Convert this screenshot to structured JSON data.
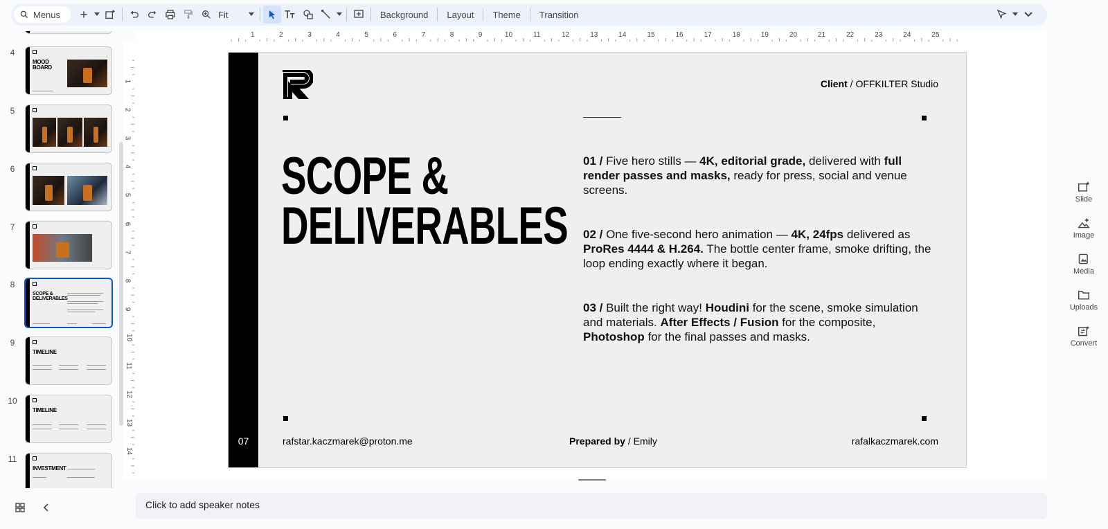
{
  "toolbar": {
    "menus_label": "Menus",
    "zoom_value": "Fit",
    "background_label": "Background",
    "layout_label": "Layout",
    "theme_label": "Theme",
    "transition_label": "Transition"
  },
  "filmstrip": {
    "slides": [
      {
        "number": "4",
        "title": "MOOD BOARD"
      },
      {
        "number": "5",
        "title": ""
      },
      {
        "number": "6",
        "title": ""
      },
      {
        "number": "7",
        "title": ""
      },
      {
        "number": "8",
        "title": "SCOPE & DELIVERABLES",
        "selected": true
      },
      {
        "number": "9",
        "title": "TIMELINE"
      },
      {
        "number": "10",
        "title": "TIMELINE"
      },
      {
        "number": "11",
        "title": "INVESTMENT"
      }
    ]
  },
  "ruler": {
    "top": [
      "1",
      "2",
      "3",
      "4",
      "5",
      "6",
      "7",
      "8",
      "9",
      "10",
      "11",
      "12",
      "13",
      "14",
      "15",
      "16",
      "17",
      "18",
      "19",
      "20",
      "21",
      "22",
      "23",
      "24",
      "25"
    ],
    "left": [
      "1",
      "2",
      "3",
      "4",
      "5",
      "6",
      "7",
      "8",
      "9",
      "10",
      "11",
      "12",
      "13",
      "14"
    ]
  },
  "slide": {
    "page_number": "07",
    "client_label": "Client",
    "client_sep": "/",
    "client_name": "OFFKILTER Studio",
    "title_line1": "SCOPE &",
    "title_line2": "DELIVERABLES",
    "items": [
      {
        "num": "01 /",
        "text_a": " Five hero stills — ",
        "bold_a": "4K, editorial grade,",
        "text_b": " delivered with ",
        "bold_b": "full render passes and masks,",
        "text_c": " ready for press, social and venue screens."
      },
      {
        "num": "02 /",
        "text_a": " One five-second hero animation — ",
        "bold_a": "4K, 24fps",
        "text_b": " delivered as ",
        "bold_b": "ProRes 4444 & H.264.",
        "text_c": " The bottle center frame, smoke drifting, the loop ending exactly where it began."
      },
      {
        "num": "03 /",
        "text_a": " Built the right way! ",
        "bold_a": "Houdini",
        "text_b": " for the scene, smoke simulation and materials. ",
        "bold_b": "After Effects / Fusion",
        "text_c": " for the composite, ",
        "bold_c": "Photoshop",
        "text_d": " for the final passes and masks."
      }
    ],
    "footer_email": "rafstar.kaczmarek@proton.me",
    "footer_prepared_label": "Prepared by",
    "footer_prepared_sep": "/",
    "footer_prepared_name": "Emily",
    "footer_website": "rafalkaczmarek.com"
  },
  "notes_placeholder": "Click to add speaker notes",
  "right_panel": {
    "slide_label": "Slide",
    "image_label": "Image",
    "media_label": "Media",
    "uploads_label": "Uploads",
    "convert_label": "Convert"
  },
  "colors": {
    "accent": "#0b57d0",
    "toolbar_bg": "#edf2fa",
    "slide_bg": "#efefef",
    "slide_bar": "#000000"
  }
}
